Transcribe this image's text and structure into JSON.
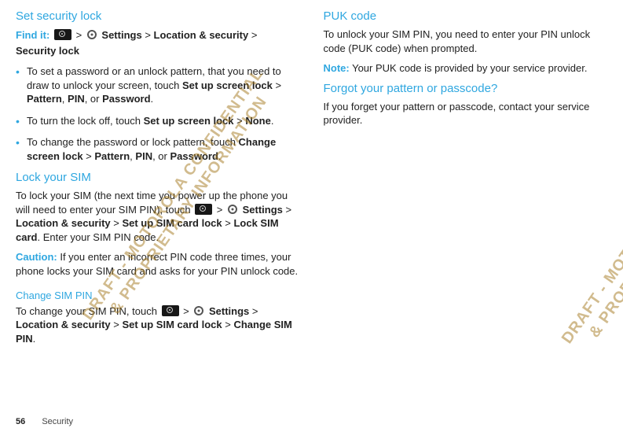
{
  "watermark": {
    "line1": "DRAFT - MOTOROLA CONFIDENTIAL",
    "line2": "& PROPRIETARY INFORMATION"
  },
  "sep": " > ",
  "comma": ", ",
  "or": ", or ",
  "period": ".",
  "left": {
    "sec1_title": "Set security lock",
    "findit_label": "Find it:",
    "settings": "Settings",
    "locsec": "Location & security",
    "seclock": "Security lock",
    "bullets": {
      "b1_a": "To set a password or an unlock pattern, that you need to draw to unlock your screen, touch ",
      "b1_setup": "Set up screen lock",
      "b1_pattern": "Pattern",
      "b1_pin": "PIN",
      "b1_password": "Password",
      "b2_a": "To turn the lock off, touch ",
      "b2_setup": "Set up screen lock",
      "b2_none": "None",
      "b3_a": "To change the password or lock pattern, touch ",
      "b3_change": "Change screen lock",
      "b3_pattern": "Pattern",
      "b3_pin": "PIN",
      "b3_password": "Password"
    },
    "sec2_title": "Lock your SIM",
    "sec2_p1a": "To lock your SIM (the next time you power up the phone you will need to enter your SIM PIN), touch ",
    "sec2_setup": "Set up SIM card lock",
    "sec2_locksim": "Lock SIM card",
    "sec2_p1b": ". Enter your SIM PIN code.",
    "caution_label": "Caution:",
    "sec2_caution": " If you enter an incorrect PIN code three times, your phone locks your SIM card and asks for your PIN unlock code.",
    "sub_title": "Change SIM PIN",
    "sub_p_a": "To change your SIM PIN, touch ",
    "sub_setup": "Set up SIM card lock",
    "sub_change": "Change SIM PIN"
  },
  "right": {
    "sec3_title": "PUK code",
    "sec3_p1": "To unlock your SIM PIN, you need to enter your PIN unlock code (PUK code) when prompted.",
    "note_label": "Note:",
    "sec3_note": " Your PUK code is provided by your service provider.",
    "sec4_title": "Forgot your pattern or passcode?",
    "sec4_p1": "If you forget your pattern or passcode, contact your service provider."
  },
  "footer": {
    "page": "56",
    "title": "Security"
  }
}
